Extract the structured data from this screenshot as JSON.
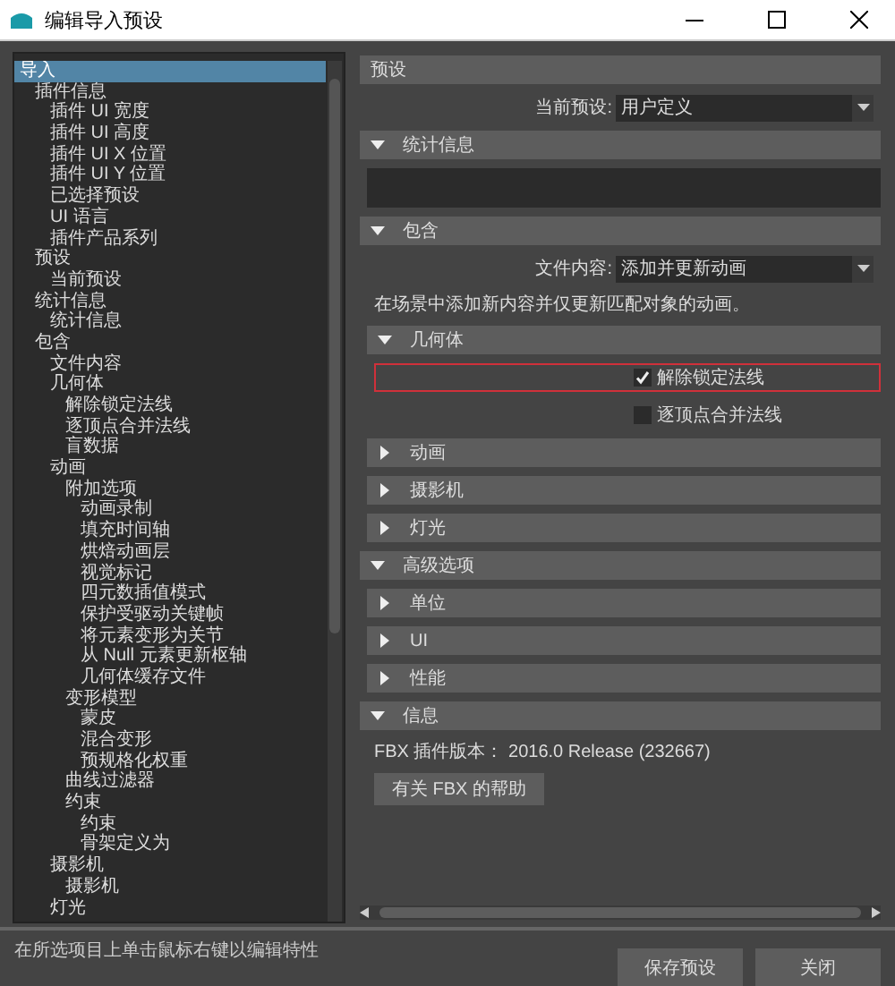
{
  "window": {
    "title": "编辑导入预设"
  },
  "tree": [
    {
      "label": "导入",
      "selected": true,
      "children": [
        {
          "label": "插件信息",
          "selected": false,
          "children": [
            {
              "label": "插件 UI 宽度",
              "selected": false
            },
            {
              "label": "插件 UI 高度",
              "selected": false
            },
            {
              "label": "插件 UI X 位置",
              "selected": false
            },
            {
              "label": "插件 UI Y 位置",
              "selected": false
            },
            {
              "label": "已选择预设",
              "selected": false
            },
            {
              "label": "UI 语言",
              "selected": false
            },
            {
              "label": "插件产品系列",
              "selected": false
            }
          ]
        },
        {
          "label": "预设",
          "selected": false,
          "children": [
            {
              "label": "当前预设",
              "selected": false
            }
          ]
        },
        {
          "label": "统计信息",
          "selected": false,
          "children": [
            {
              "label": "统计信息",
              "selected": false
            }
          ]
        },
        {
          "label": "包含",
          "selected": false,
          "children": [
            {
              "label": "文件内容",
              "selected": false
            },
            {
              "label": "几何体",
              "selected": false,
              "children": [
                {
                  "label": "解除锁定法线",
                  "selected": false
                },
                {
                  "label": "逐顶点合并法线",
                  "selected": false
                },
                {
                  "label": "盲数据",
                  "selected": false
                }
              ]
            },
            {
              "label": "动画",
              "selected": false,
              "children": [
                {
                  "label": "附加选项",
                  "selected": false,
                  "children": [
                    {
                      "label": "动画录制",
                      "selected": false
                    },
                    {
                      "label": "填充时间轴",
                      "selected": false
                    },
                    {
                      "label": "烘焙动画层",
                      "selected": false
                    },
                    {
                      "label": "视觉标记",
                      "selected": false
                    },
                    {
                      "label": "四元数插值模式",
                      "selected": false
                    },
                    {
                      "label": "保护受驱动关键帧",
                      "selected": false
                    },
                    {
                      "label": "将元素变形为关节",
                      "selected": false
                    },
                    {
                      "label": "从 Null 元素更新枢轴",
                      "selected": false
                    },
                    {
                      "label": "几何体缓存文件",
                      "selected": false
                    }
                  ]
                },
                {
                  "label": "变形模型",
                  "selected": false,
                  "children": [
                    {
                      "label": "蒙皮",
                      "selected": false
                    },
                    {
                      "label": "混合变形",
                      "selected": false
                    },
                    {
                      "label": "预规格化权重",
                      "selected": false
                    }
                  ]
                },
                {
                  "label": "曲线过滤器",
                  "selected": false
                },
                {
                  "label": "约束",
                  "selected": false,
                  "children": [
                    {
                      "label": "约束",
                      "selected": false
                    },
                    {
                      "label": "骨架定义为",
                      "selected": false
                    }
                  ]
                }
              ]
            },
            {
              "label": "摄影机",
              "selected": false,
              "children": [
                {
                  "label": "摄影机",
                  "selected": false
                }
              ]
            },
            {
              "label": "灯光",
              "selected": false
            }
          ]
        }
      ]
    }
  ],
  "panel": [
    {
      "kind": "header",
      "title": "预设"
    },
    {
      "kind": "dropdown",
      "label": "当前预设:",
      "value": "用户定义"
    },
    {
      "kind": "section",
      "title": "统计信息",
      "expanded": true,
      "children": [
        {
          "kind": "blank"
        }
      ]
    },
    {
      "kind": "section",
      "title": "包含",
      "expanded": true,
      "children": [
        {
          "kind": "dropdown",
          "label": "文件内容:",
          "value": "添加并更新动画"
        },
        {
          "kind": "note",
          "text": "在场景中添加新内容并仅更新匹配对象的动画。"
        },
        {
          "kind": "section",
          "title": "几何体",
          "expanded": true,
          "children": [
            {
              "kind": "checkbox",
              "label": "解除锁定法线",
              "checked": true,
              "highlighted": true
            },
            {
              "kind": "checkbox",
              "label": "逐顶点合并法线",
              "checked": false,
              "highlighted": false
            }
          ]
        },
        {
          "kind": "section",
          "title": "动画",
          "expanded": false
        },
        {
          "kind": "section",
          "title": "摄影机",
          "expanded": false
        },
        {
          "kind": "section",
          "title": "灯光",
          "expanded": false
        }
      ]
    },
    {
      "kind": "section",
      "title": "高级选项",
      "expanded": true,
      "children": [
        {
          "kind": "section",
          "title": "单位",
          "expanded": false
        },
        {
          "kind": "section",
          "title": "UI",
          "expanded": false
        },
        {
          "kind": "section",
          "title": "性能",
          "expanded": false
        }
      ]
    },
    {
      "kind": "section",
      "title": "信息",
      "expanded": true,
      "children": [
        {
          "kind": "note",
          "text": "FBX 插件版本： 2016.0 Release (232667)"
        },
        {
          "kind": "button",
          "label": "有关 FBX 的帮助"
        }
      ]
    }
  ],
  "status_bar": {
    "text": "在所选项目上单击鼠标右键以编辑特性"
  },
  "buttons": [
    "保存预设",
    "关闭"
  ]
}
